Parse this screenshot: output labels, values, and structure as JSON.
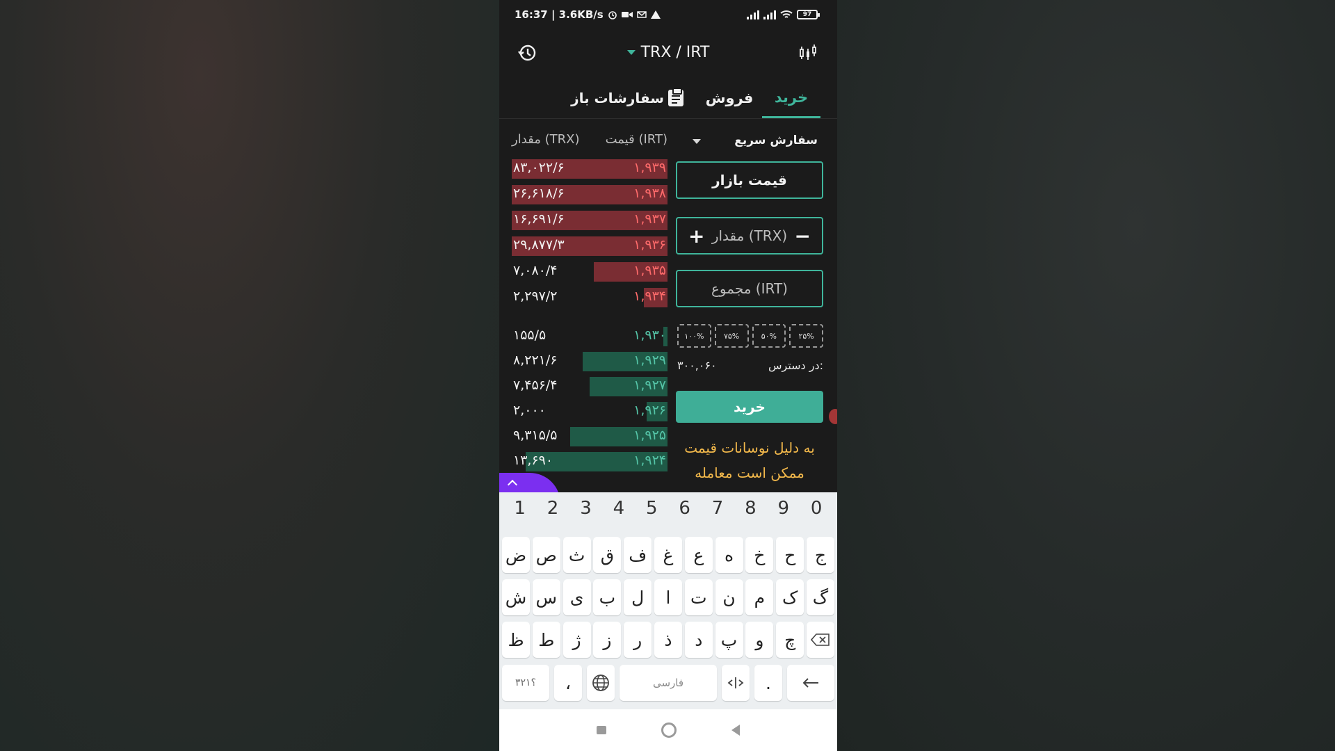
{
  "status": {
    "time_speed": "16:37 | 3.6KB/s",
    "battery": "97"
  },
  "header": {
    "pair": "TRX / IRT"
  },
  "tabs": {
    "buy": "خرید",
    "sell": "فروش",
    "orders": "سفارشات باز"
  },
  "book": {
    "amount_header": "مقدار (TRX)",
    "price_header": "قیمت (IRT)",
    "asks": [
      {
        "amount": "۸۳,۰۲۲/۶",
        "price": "۱,۹۳۹"
      },
      {
        "amount": "۲۶,۶۱۸/۶",
        "price": "۱,۹۳۸"
      },
      {
        "amount": "۱۶,۶۹۱/۶",
        "price": "۱,۹۳۷"
      },
      {
        "amount": "۲۹,۸۷۷/۳",
        "price": "۱,۹۳۶"
      },
      {
        "amount": "۷,۰۸۰/۴",
        "price": "۱,۹۳۵"
      },
      {
        "amount": "۲,۲۹۷/۲",
        "price": "۱,۹۳۴"
      }
    ],
    "bids": [
      {
        "amount": "۱۵۵/۵",
        "price": "۱,۹۳۰"
      },
      {
        "amount": "۸,۲۲۱/۶",
        "price": "۱,۹۲۹"
      },
      {
        "amount": "۷,۴۵۶/۴",
        "price": "۱,۹۲۷"
      },
      {
        "amount": "۲,۰۰۰",
        "price": "۱,۹۲۶"
      },
      {
        "amount": "۹,۳۱۵/۵",
        "price": "۱,۹۲۵"
      },
      {
        "amount": "۱۳,۶۹۰",
        "price": "۱,۹۲۴"
      }
    ]
  },
  "form": {
    "order_type": "سفارش سریع",
    "market_price": "قیمت بازار",
    "quantity_placeholder": "مقدار (TRX)",
    "total_placeholder": "مجموع (IRT)",
    "percents": [
      "۱۰۰%",
      "۷۵%",
      "۵۰%",
      "۲۵%"
    ],
    "available_label": "در دسترس:",
    "available_value": "۳۰۰,۰۶۰",
    "buy_button": "خرید",
    "warning": "به دلیل نوسانات قیمت ممکن است معامله"
  },
  "keyboard": {
    "numbers": [
      "1",
      "2",
      "3",
      "4",
      "5",
      "6",
      "7",
      "8",
      "9",
      "0"
    ],
    "row1": [
      "ض",
      "ص",
      "ث",
      "ق",
      "ف",
      "غ",
      "ع",
      "ه",
      "خ",
      "ح",
      "ج"
    ],
    "row2": [
      "ش",
      "س",
      "ی",
      "ب",
      "ل",
      "ا",
      "ت",
      "ن",
      "م",
      "ک",
      "گ"
    ],
    "row3": [
      "ظ",
      "ط",
      "ژ",
      "ز",
      "ر",
      "ذ",
      "د",
      "پ",
      "و",
      "چ"
    ],
    "symbols_key": "؟۳۲۱",
    "comma_key": "،",
    "space_label": "فارسی",
    "period_key": "."
  }
}
